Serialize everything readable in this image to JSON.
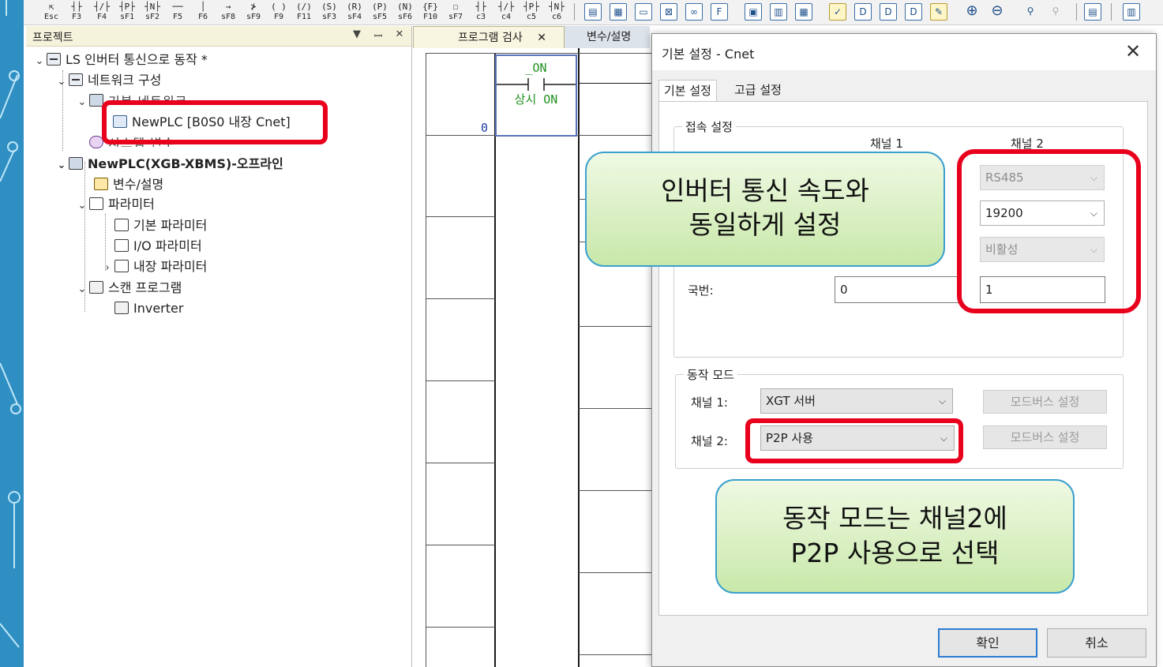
{
  "toolbar": {
    "keys": [
      {
        "sym": "⇱",
        "label": "Esc"
      },
      {
        "sym": "┤├",
        "label": "F3"
      },
      {
        "sym": "┤/├",
        "label": "F4"
      },
      {
        "sym": "┤P├",
        "label": "sF1"
      },
      {
        "sym": "┤N├",
        "label": "sF2"
      },
      {
        "sym": "──",
        "label": "F5"
      },
      {
        "sym": "│",
        "label": "F6"
      },
      {
        "sym": "→",
        "label": "sF8"
      },
      {
        "sym": "⊁",
        "label": "sF9"
      },
      {
        "sym": "( )",
        "label": "F9"
      },
      {
        "sym": "(/)",
        "label": "F11"
      },
      {
        "sym": "(S)",
        "label": "sF3"
      },
      {
        "sym": "(R)",
        "label": "sF4"
      },
      {
        "sym": "(P)",
        "label": "sF5"
      },
      {
        "sym": "(N)",
        "label": "sF6"
      },
      {
        "sym": "{F}",
        "label": "F10"
      },
      {
        "sym": "☐",
        "label": "sF7"
      },
      {
        "sym": "┤├",
        "label": "c3"
      },
      {
        "sym": "┤/├",
        "label": "c4"
      },
      {
        "sym": "┤P├",
        "label": "c5"
      },
      {
        "sym": "┤N├",
        "label": "c6"
      }
    ]
  },
  "project": {
    "panel_title": "프로젝트",
    "root": "LS 인버터 통신으로 동작 *",
    "network": "네트워크 구성",
    "basic_network_obscured": "기본 네트워크",
    "newplc_cnet": "NewPLC [B0S0 내장 Cnet]",
    "system_var_obscured": "시스템 변수",
    "newplc_offline": "NewPLC(XGB-XBMS)-오프라인",
    "var_desc": "변수/설명",
    "params": "파라미터",
    "basic_param": "기본 파라미터",
    "io_param": "I/O 파라미터",
    "builtin_param": "내장 파라미터",
    "scan_program": "스캔 프로그램",
    "inverter": "Inverter"
  },
  "tabs": {
    "program_check": "프로그램 검사",
    "var_desc": "변수/설명"
  },
  "ladder": {
    "contact_name": "_ON",
    "contact_desc": "상시 ON",
    "step": "0"
  },
  "dialog": {
    "title": "기본 설정 - Cnet",
    "close": "✕",
    "tab_basic": "기본 설정",
    "tab_advanced": "고급 설정",
    "connection_group": "접속 설정",
    "channel1_head": "채널 1",
    "channel2_head": "채널 2",
    "ch2_type": "RS485",
    "ch2_speed": "19200",
    "ch2_modem": "비활성",
    "station_label": "국번:",
    "ch1_station": "0",
    "ch2_station": "1",
    "mode_group": "동작 모드",
    "mode_ch1_label": "채널 1:",
    "mode_ch1_value": "XGT 서버",
    "mode_ch2_label": "채널 2:",
    "mode_ch2_value": "P2P 사용",
    "modbus_btn1": "모드버스 설정",
    "modbus_btn2": "모드버스 설정",
    "ok": "확인",
    "cancel": "취소"
  },
  "callouts": {
    "speed_line1": "인버터 통신 속도와",
    "speed_line2": "동일하게 설정",
    "mode_line1": "동작 모드는 채널2에",
    "mode_line2": "P2P 사용으로 선택"
  },
  "colors": {
    "highlight": "#e8001c",
    "callout_border": "#3aa0cf",
    "callout_fill": "#d9f0c2",
    "slide_accent": "#2f8fc3"
  }
}
